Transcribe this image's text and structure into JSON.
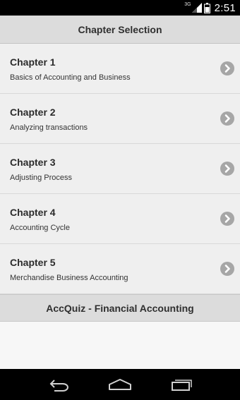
{
  "status_bar": {
    "network_label": "3G",
    "time": "2:51",
    "signal_icon": "signal-icon",
    "battery_icon": "battery-icon"
  },
  "header": {
    "title": "Chapter Selection"
  },
  "chapters": [
    {
      "title": "Chapter 1",
      "subtitle": "Basics of Accounting and Business"
    },
    {
      "title": "Chapter 2",
      "subtitle": "Analyzing transactions"
    },
    {
      "title": "Chapter 3",
      "subtitle": "Adjusting Process"
    },
    {
      "title": "Chapter 4",
      "subtitle": "Accounting Cycle"
    },
    {
      "title": "Chapter 5",
      "subtitle": "Merchandise Business Accounting"
    }
  ],
  "footer": {
    "title": "AccQuiz - Financial Accounting"
  },
  "nav_bar": {
    "back_icon": "back-icon",
    "home_icon": "home-icon",
    "recents_icon": "recents-icon"
  },
  "colors": {
    "header_bg": "#dcdcdc",
    "item_bg": "#efefef",
    "chevron": "#a6a6a6"
  }
}
